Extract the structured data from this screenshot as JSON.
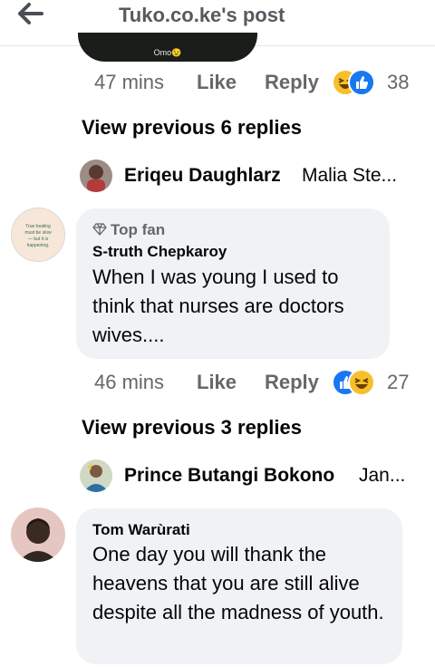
{
  "header": {
    "title": "Tuko.co.ke's post",
    "back_icon": "arrow-left-icon"
  },
  "top_media": {
    "caption": "Omo😉"
  },
  "comment0_meta": {
    "time": "47 mins",
    "like": "Like",
    "reply": "Reply",
    "reactions": [
      "haha",
      "like"
    ],
    "count": "38"
  },
  "view_prev_1": "View previous 6 replies",
  "reply_preview_1": {
    "name": "Eriqeu Daughlarz",
    "snippet": "Malia Ste..."
  },
  "comment1": {
    "badge": "Top fan",
    "author": "S-truth Chepkaroy",
    "text": "When I was young I used to think that nurses are doctors wives....",
    "avatar_text": "True healing must be slow — but it is happening."
  },
  "comment1_meta": {
    "time": "46 mins",
    "like": "Like",
    "reply": "Reply",
    "reactions": [
      "like",
      "haha"
    ],
    "count": "27"
  },
  "view_prev_2": "View previous 3 replies",
  "reply_preview_2": {
    "name": "Prince Butangi Bokono",
    "snippet": "Jan..."
  },
  "comment2": {
    "author": "Tom Warùrati",
    "text": "One day you will thank the heavens that you are still alive despite all the madness of youth."
  },
  "colors": {
    "accent": "#1877f2",
    "haha": "#f7c02b",
    "bubble": "#f0f2f5",
    "meta": "#65676b"
  }
}
